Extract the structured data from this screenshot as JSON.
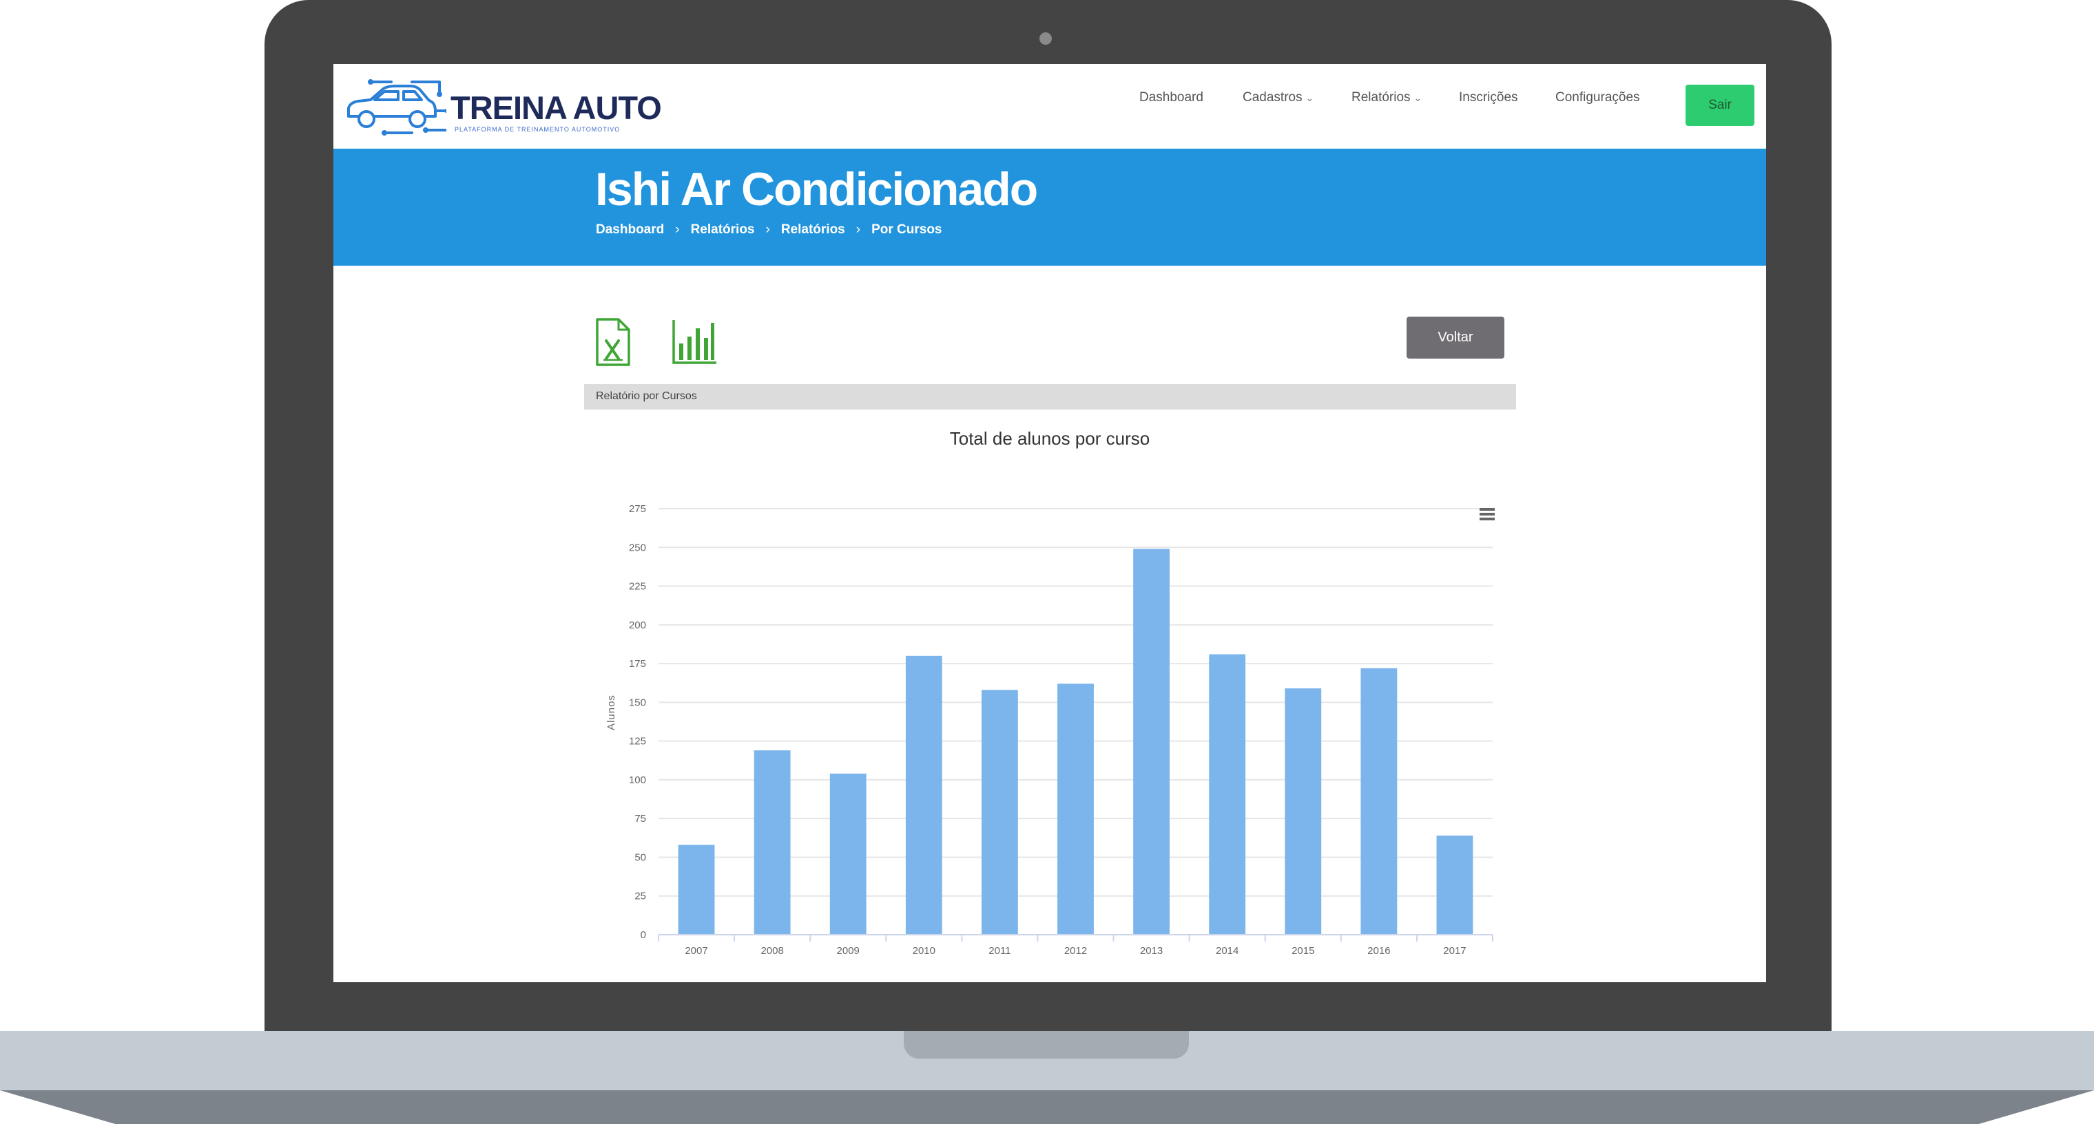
{
  "brand": {
    "name": "TREINA AUTO",
    "tagline": "PLATAFORMA DE TREINAMENTO AUTOMOTIVO",
    "accent": "#2294de"
  },
  "nav": {
    "items": [
      {
        "label": "Dashboard",
        "dropdown": false
      },
      {
        "label": "Cadastros",
        "dropdown": true
      },
      {
        "label": "Relatórios",
        "dropdown": true
      },
      {
        "label": "Inscrições",
        "dropdown": false
      },
      {
        "label": "Configurações",
        "dropdown": false
      }
    ],
    "logout_label": "Sair",
    "logout_color": "#2ecc71"
  },
  "page": {
    "title": "Ishi Ar Condicionado",
    "breadcrumb": [
      "Dashboard",
      "Relatórios",
      "Relatórios",
      "Por Cursos"
    ],
    "breadcrumb_separator": "›"
  },
  "toolbar": {
    "excel_icon": "excel-file-icon",
    "chart_icon": "bar-chart-icon",
    "icon_color": "#3fa535",
    "back_label": "Voltar"
  },
  "section": {
    "label": "Relatório por Cursos"
  },
  "chart_data": {
    "type": "bar",
    "title": "Total de alunos por curso",
    "xlabel": "",
    "ylabel": "Alunos",
    "categories": [
      "2007",
      "2008",
      "2009",
      "2010",
      "2011",
      "2012",
      "2013",
      "2014",
      "2015",
      "2016",
      "2017"
    ],
    "values": [
      58,
      119,
      104,
      180,
      158,
      162,
      249,
      181,
      159,
      172,
      64
    ],
    "ylim": [
      0,
      275
    ],
    "yticks": [
      0,
      25,
      50,
      75,
      100,
      125,
      150,
      175,
      200,
      225,
      250,
      275
    ],
    "grid": true,
    "bar_color": "#7cb5ec",
    "menu_icon": "hamburger-menu-icon"
  }
}
